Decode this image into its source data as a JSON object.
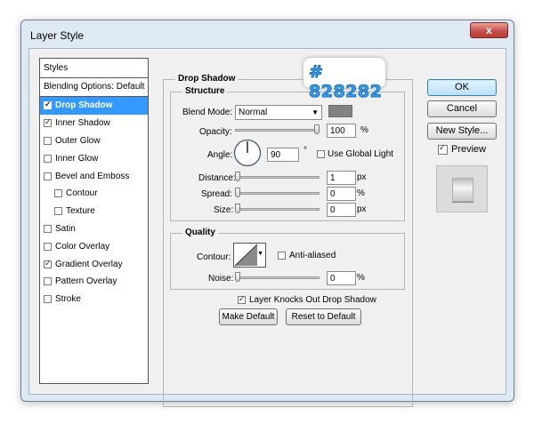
{
  "window": {
    "title": "Layer Style",
    "close_glyph": "x"
  },
  "callout": {
    "text": "# 828282",
    "color": "#3da0e8"
  },
  "styles": {
    "header": "Styles",
    "blending": "Blending Options: Default",
    "items": [
      {
        "label": "Drop Shadow",
        "checked": true,
        "selected": true,
        "indent": false
      },
      {
        "label": "Inner Shadow",
        "checked": true,
        "selected": false,
        "indent": false
      },
      {
        "label": "Outer Glow",
        "checked": false,
        "selected": false,
        "indent": false
      },
      {
        "label": "Inner Glow",
        "checked": false,
        "selected": false,
        "indent": false
      },
      {
        "label": "Bevel and Emboss",
        "checked": false,
        "selected": false,
        "indent": false
      },
      {
        "label": "Contour",
        "checked": false,
        "selected": false,
        "indent": true
      },
      {
        "label": "Texture",
        "checked": false,
        "selected": false,
        "indent": true
      },
      {
        "label": "Satin",
        "checked": false,
        "selected": false,
        "indent": false
      },
      {
        "label": "Color Overlay",
        "checked": false,
        "selected": false,
        "indent": false
      },
      {
        "label": "Gradient Overlay",
        "checked": true,
        "selected": false,
        "indent": false
      },
      {
        "label": "Pattern Overlay",
        "checked": false,
        "selected": false,
        "indent": false
      },
      {
        "label": "Stroke",
        "checked": false,
        "selected": false,
        "indent": false
      }
    ]
  },
  "panel": {
    "title": "Drop Shadow",
    "structure": {
      "title": "Structure",
      "blend_mode_label": "Blend Mode:",
      "blend_mode_value": "Normal",
      "shadow_color": "#828282",
      "opacity_label": "Opacity:",
      "opacity_value": "100",
      "opacity_level": 1.0,
      "percent": "%",
      "angle_label": "Angle:",
      "angle_value": "90",
      "degree": "°",
      "global_light_label": "Use Global Light",
      "global_light_checked": false,
      "distance_label": "Distance:",
      "distance_value": "1",
      "spread_label": "Spread:",
      "spread_value": "0",
      "size_label": "Size:",
      "size_value": "0",
      "px": "px"
    },
    "quality": {
      "title": "Quality",
      "contour_label": "Contour:",
      "anti_aliased_label": "Anti-aliased",
      "anti_aliased_checked": false,
      "noise_label": "Noise:",
      "noise_value": "0",
      "percent": "%"
    },
    "knockout_label": "Layer Knocks Out Drop Shadow",
    "knockout_checked": true,
    "make_default": "Make Default",
    "reset_default": "Reset to Default"
  },
  "buttons": {
    "ok": "OK",
    "cancel": "Cancel",
    "new_style": "New Style...",
    "preview_label": "Preview",
    "preview_checked": true
  }
}
